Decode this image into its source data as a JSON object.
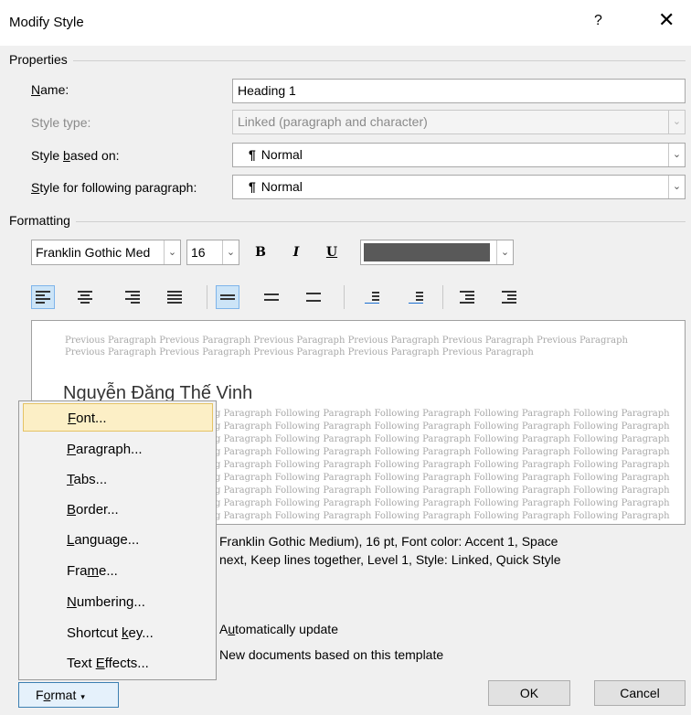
{
  "dialog": {
    "title": "Modify Style",
    "help_label": "?",
    "close_label": "✕"
  },
  "properties": {
    "group_label": "Properties",
    "name_label_pre": "",
    "name_label_ul": "N",
    "name_label_post": "ame:",
    "name_value": "Heading 1",
    "style_type_label": "Style type:",
    "style_type_value": "Linked (paragraph and character)",
    "based_on_label_pre": "Style ",
    "based_on_label_ul": "b",
    "based_on_label_post": "ased on:",
    "based_on_value": "Normal",
    "following_label_pre": "",
    "following_label_ul": "S",
    "following_label_post": "tyle for following paragraph:",
    "following_value": "Normal",
    "pilcrow": "¶"
  },
  "formatting": {
    "group_label": "Formatting",
    "font_value": "Franklin Gothic Med",
    "size_value": "16",
    "bold_label": "B",
    "italic_label": "I",
    "underline_label": "U",
    "font_color": "#595959"
  },
  "preview": {
    "previous_text": "Previous Paragraph Previous Paragraph Previous Paragraph Previous Paragraph Previous Paragraph Previous Paragraph Previous Paragraph Previous Paragraph Previous Paragraph Previous Paragraph Previous Paragraph",
    "sample_text": "Nguyễn Đăng Thế Vinh",
    "following_line": "g Paragraph Following Paragraph Following Paragraph Following Paragraph Following Paragraph"
  },
  "description": {
    "line1": "Franklin Gothic Medium), 16 pt, Font color: Accent 1, Space",
    "line2": "next, Keep lines together, Level 1, Style: Linked, Quick Style"
  },
  "options": {
    "auto_update_pre": "A",
    "auto_update_ul": "u",
    "auto_update_post": "tomatically update",
    "new_docs_label": "New documents based on this template"
  },
  "buttons": {
    "ok_label": "OK",
    "cancel_label": "Cancel",
    "format_pre": "F",
    "format_ul": "o",
    "format_post": "rmat",
    "format_arrow": "▾"
  },
  "format_menu": [
    {
      "pre": "",
      "ul": "F",
      "post": "ont..."
    },
    {
      "pre": "",
      "ul": "P",
      "post": "aragraph..."
    },
    {
      "pre": "",
      "ul": "T",
      "post": "abs..."
    },
    {
      "pre": "",
      "ul": "B",
      "post": "order..."
    },
    {
      "pre": "",
      "ul": "L",
      "post": "anguage..."
    },
    {
      "pre": "Fra",
      "ul": "m",
      "post": "e..."
    },
    {
      "pre": "",
      "ul": "N",
      "post": "umbering..."
    },
    {
      "pre": "Shortcut ",
      "ul": "k",
      "post": "ey..."
    },
    {
      "pre": "Text ",
      "ul": "E",
      "post": "ffects..."
    }
  ]
}
